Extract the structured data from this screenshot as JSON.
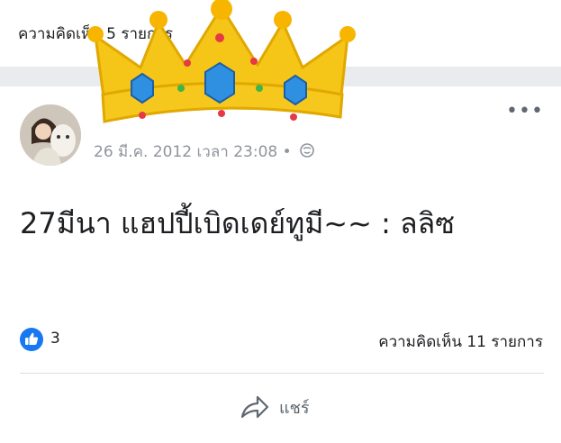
{
  "header": {
    "comments_text": "ความคิดเห็น 5 รายการ"
  },
  "post": {
    "timestamp": "26 มี.ค. 2012 เวลา 23:08 •",
    "text": "27มีนา แฮปปี้เบิดเดย์ทูมี~~ : ลลิซ",
    "like_count": "3",
    "comment_count": "ความคิดเห็น 11 รายการ",
    "share_label": "แชร์",
    "more_label": "•••"
  },
  "colors": {
    "like_blue": "#1877f2",
    "crown_gold": "#f5c518",
    "gem_blue": "#2f8fe0"
  },
  "icons": [
    "like-icon",
    "globe-icon",
    "share-icon",
    "more-icon",
    "crown-sticker"
  ]
}
